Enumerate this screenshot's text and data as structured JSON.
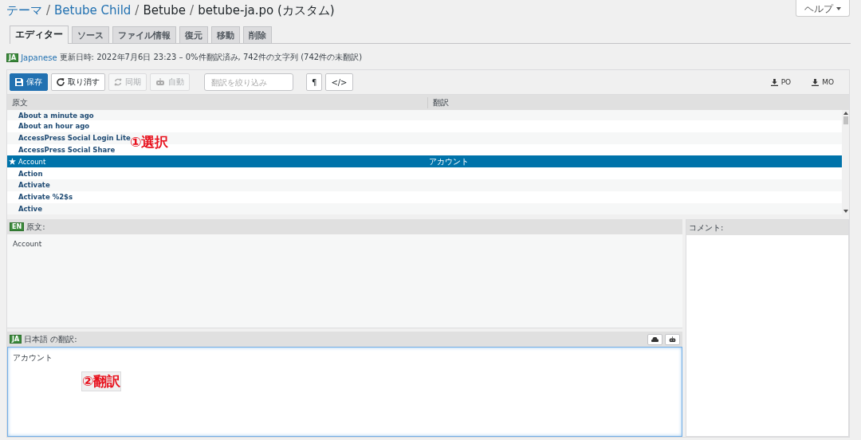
{
  "breadcrumb": [
    {
      "kind": "item",
      "label": "テーマ",
      "link": true
    },
    {
      "kind": "separator",
      "label": "/"
    },
    {
      "kind": "item",
      "label": "Betube Child",
      "link": true
    },
    {
      "kind": "separator",
      "label": "/"
    },
    {
      "kind": "item",
      "label": "Betube",
      "link": false
    },
    {
      "kind": "separator",
      "label": "/"
    },
    {
      "kind": "item",
      "label": "betube-ja.po (カスタム)",
      "link": false
    }
  ],
  "help_button": {
    "label": "ヘルプ"
  },
  "tabs": [
    {
      "label": "エディター",
      "selected": true
    },
    {
      "label": "ソース",
      "selected": false
    },
    {
      "label": "ファイル情報",
      "selected": false
    },
    {
      "label": "復元",
      "selected": false
    },
    {
      "label": "移動",
      "selected": false
    },
    {
      "label": "削除",
      "selected": false
    }
  ],
  "info": {
    "flag": "JA",
    "language": "Japanese",
    "text": "更新日時: 2022年7月6日 23:23 – 0%件翻訳済み, 742件の文字列 (742件の未翻訳)"
  },
  "toolbar": {
    "buttons": [
      {
        "kind": "save",
        "label": "保存",
        "primary": true,
        "disabled": false
      },
      {
        "kind": "revert",
        "label": "取り消す",
        "primary": false,
        "disabled": false
      },
      {
        "kind": "sync",
        "label": "同期",
        "primary": false,
        "disabled": true
      },
      {
        "kind": "auto",
        "label": "自動",
        "primary": false,
        "disabled": true
      }
    ],
    "filter": {
      "placeholder": "翻訳を絞り込み"
    },
    "toggles": [
      {
        "label": "¶"
      },
      {
        "label": "</>"
      }
    ],
    "downloads": [
      {
        "label": "PO"
      },
      {
        "label": "MO"
      }
    ]
  },
  "list": {
    "columns": [
      "原文",
      "翻訳"
    ],
    "rows": [
      {
        "source": "About a minute ago",
        "selected": false
      },
      {
        "source": "About an hour ago",
        "selected": false
      },
      {
        "source": "AccessPress Social Login Lite",
        "selected": false
      },
      {
        "source": "AccessPress Social Share",
        "selected": false
      },
      {
        "source": "Account",
        "translation": "アカウント",
        "selected": true
      },
      {
        "source": "Action",
        "selected": false
      },
      {
        "source": "Activate",
        "selected": false
      },
      {
        "source": "Activate %2$s",
        "selected": false
      },
      {
        "source": "Active",
        "selected": false
      }
    ]
  },
  "source_pane": {
    "flag": "EN",
    "title": "原文:",
    "text": "Account"
  },
  "translation_pane": {
    "flag": "JA",
    "title": "日本語 の翻訳:",
    "value": "アカウント"
  },
  "comment_pane": {
    "title": "コメント:"
  },
  "annotations": [
    {
      "text": "①選択"
    },
    {
      "text": "②翻訳"
    }
  ]
}
